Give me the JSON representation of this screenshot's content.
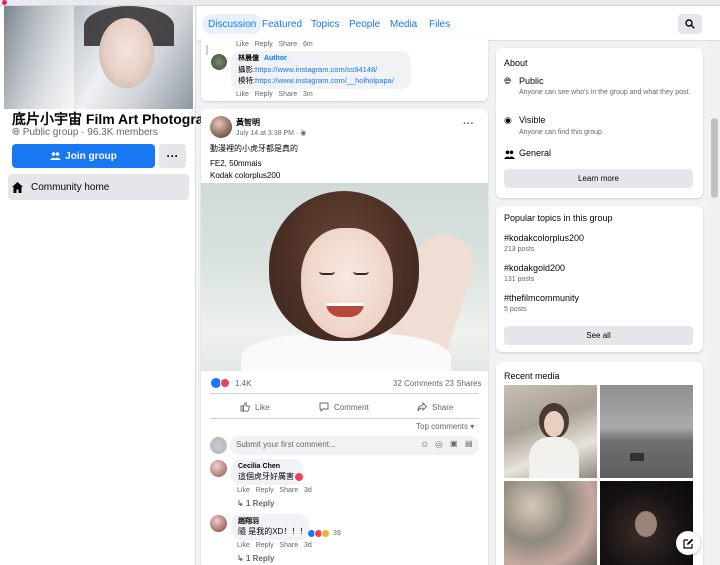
{
  "left": {
    "group_name": "底片小宇宙 Film Art Photography",
    "group_meta": "Public group · 96.3K members",
    "join_label": "Join group",
    "more_label": "···",
    "community_home": "Community home"
  },
  "nav": {
    "tabs": [
      "Discussion",
      "Featured",
      "Topics",
      "People",
      "Media",
      "Files"
    ],
    "active_tab": "Discussion"
  },
  "prev_post": {
    "actions": [
      "Like",
      "Reply",
      "Share"
    ],
    "time_1": "6m",
    "author_name": "林晨億",
    "author_badge": "Author",
    "line1_prefix": "攝影:",
    "line1_link": "https://www.instagram.com/ss94148/",
    "line2_prefix": "模特:",
    "line2_link": "https://www.instagram.com/__holholpapa/",
    "time_2": "3m"
  },
  "post": {
    "author": "黃智明",
    "time": "July 14 at 3:38 PM ·",
    "menu": "···",
    "text_1": "動漫裡的小虎牙都是真的",
    "text_2": "FE2, 50mmais",
    "text_3": "Kodak colorplus200",
    "reactions_count": "1.4K",
    "comments_count": "32 Comments",
    "shares_count": "23 Shares",
    "like_label": "Like",
    "comment_label": "Comment",
    "share_label": "Share",
    "sort_label": "Top comments",
    "comment_placeholder": "Submit your first comment...",
    "comments": [
      {
        "name": "Cecilia Chen",
        "text": "這個虎牙好厲害",
        "time": "3d",
        "replies": "1 Reply"
      },
      {
        "name": "趙翔羽",
        "text": "隨 是我的XD！！！",
        "reaction_count": "39",
        "time": "3d",
        "replies": "1 Reply"
      }
    ],
    "comment_actions": [
      "Like",
      "Reply",
      "Share"
    ]
  },
  "about": {
    "title": "About",
    "public_title": "Public",
    "public_desc": "Anyone can see who's in the group and what they post.",
    "visible_title": "Visible",
    "visible_desc": "Anyone can find this group.",
    "general": "General",
    "learn_more": "Learn more"
  },
  "topics": {
    "title": "Popular topics in this group",
    "items": [
      {
        "tag": "#kodakcolorplus200",
        "count": "213 posts"
      },
      {
        "tag": "#kodakgold200",
        "count": "131 posts"
      },
      {
        "tag": "#thefilmcommunity",
        "count": "5 posts"
      }
    ],
    "see_all": "See all"
  },
  "media": {
    "title": "Recent media"
  },
  "colors": {
    "brand_blue": "#1877f2",
    "bg": "#f0f2f5",
    "love_red": "#f33e58"
  }
}
